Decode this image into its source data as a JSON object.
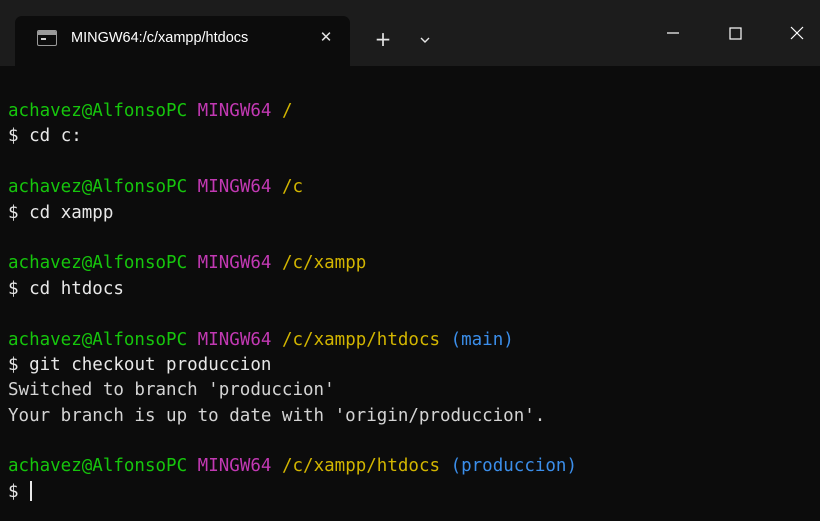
{
  "window": {
    "tab_title": "MINGW64:/c/xampp/htdocs",
    "tab_close_glyph": "✕",
    "new_tab_glyph": "+",
    "icons": {
      "tab": "terminal-icon",
      "close_tab": "close-icon",
      "new_tab": "plus-icon",
      "dropdown": "chevron-down-icon",
      "minimize": "minimize-icon",
      "maximize": "maximize-icon",
      "close_window": "close-icon"
    }
  },
  "colors": {
    "background": "#0c0c0c",
    "titlebar": "#1c1c1c",
    "user": "#16c60c",
    "system": "#c239b3",
    "path": "#d2b500",
    "branch": "#3b8eea",
    "text": "#d4d4d4"
  },
  "terminal": {
    "prompt_symbol": "$",
    "blocks": [
      {
        "user": "achavez@AlfonsoPC",
        "system": "MINGW64",
        "path": "/",
        "branch": "",
        "command": "cd c:",
        "output": []
      },
      {
        "user": "achavez@AlfonsoPC",
        "system": "MINGW64",
        "path": "/c",
        "branch": "",
        "command": "cd xampp",
        "output": []
      },
      {
        "user": "achavez@AlfonsoPC",
        "system": "MINGW64",
        "path": "/c/xampp",
        "branch": "",
        "command": "cd htdocs",
        "output": []
      },
      {
        "user": "achavez@AlfonsoPC",
        "system": "MINGW64",
        "path": "/c/xampp/htdocs",
        "branch": "(main)",
        "command": "git checkout produccion",
        "output": [
          "Switched to branch 'produccion'",
          "Your branch is up to date with 'origin/produccion'."
        ]
      },
      {
        "user": "achavez@AlfonsoPC",
        "system": "MINGW64",
        "path": "/c/xampp/htdocs",
        "branch": "(produccion)",
        "command": "",
        "output": []
      }
    ]
  }
}
